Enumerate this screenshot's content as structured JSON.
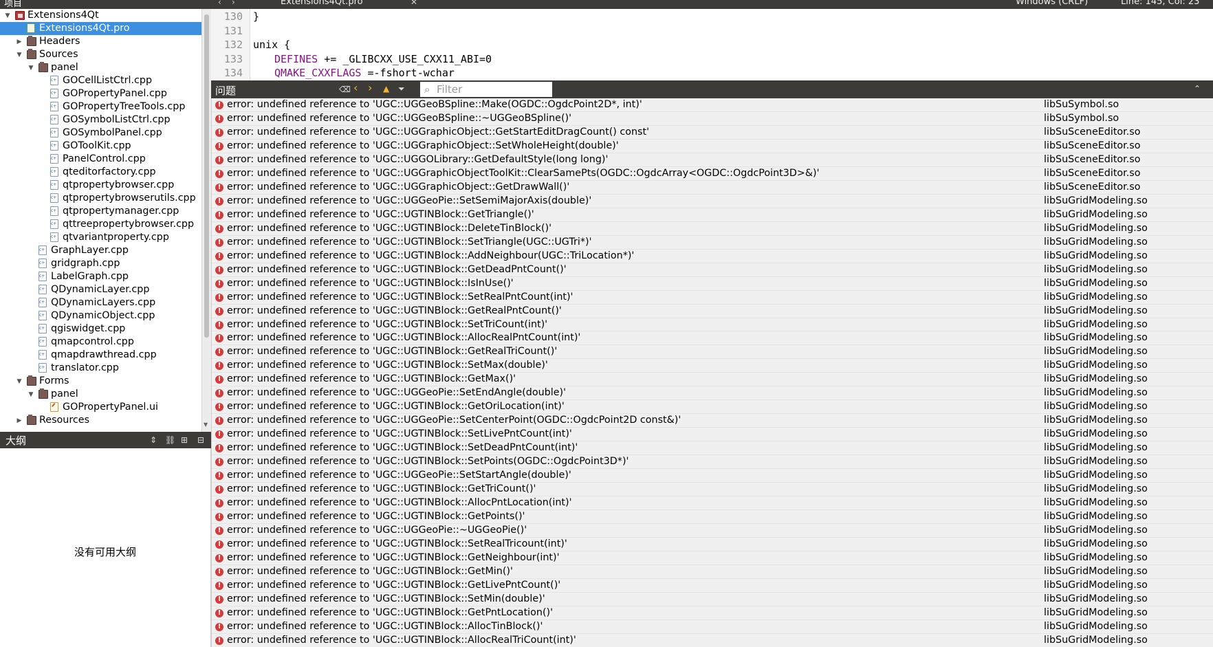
{
  "project_pane": {
    "title": "项目",
    "tree": [
      {
        "label": "Extensions4Qt",
        "type": "proj",
        "depth": 0,
        "arrow": "down"
      },
      {
        "label": "Extensions4Qt.pro",
        "type": "pro",
        "depth": 1,
        "selected": true
      },
      {
        "label": "Headers",
        "type": "folder",
        "depth": 1,
        "arrow": "right"
      },
      {
        "label": "Sources",
        "type": "folder",
        "depth": 1,
        "arrow": "down"
      },
      {
        "label": "panel",
        "type": "folder",
        "depth": 2,
        "arrow": "down"
      },
      {
        "label": "GOCellListCtrl.cpp",
        "type": "cpp",
        "depth": 3
      },
      {
        "label": "GOPropertyPanel.cpp",
        "type": "cpp",
        "depth": 3
      },
      {
        "label": "GOPropertyTreeTools.cpp",
        "type": "cpp",
        "depth": 3
      },
      {
        "label": "GOSymbolListCtrl.cpp",
        "type": "cpp",
        "depth": 3
      },
      {
        "label": "GOSymbolPanel.cpp",
        "type": "cpp",
        "depth": 3
      },
      {
        "label": "GOToolKit.cpp",
        "type": "cpp",
        "depth": 3
      },
      {
        "label": "PanelControl.cpp",
        "type": "cpp",
        "depth": 3
      },
      {
        "label": "qteditorfactory.cpp",
        "type": "cpp",
        "depth": 3
      },
      {
        "label": "qtpropertybrowser.cpp",
        "type": "cpp",
        "depth": 3
      },
      {
        "label": "qtpropertybrowserutils.cpp",
        "type": "cpp",
        "depth": 3
      },
      {
        "label": "qtpropertymanager.cpp",
        "type": "cpp",
        "depth": 3
      },
      {
        "label": "qttreepropertybrowser.cpp",
        "type": "cpp",
        "depth": 3
      },
      {
        "label": "qtvariantproperty.cpp",
        "type": "cpp",
        "depth": 3
      },
      {
        "label": "GraphLayer.cpp",
        "type": "cpp",
        "depth": 2
      },
      {
        "label": "gridgraph.cpp",
        "type": "cpp",
        "depth": 2
      },
      {
        "label": "LabelGraph.cpp",
        "type": "cpp",
        "depth": 2
      },
      {
        "label": "QDynamicLayer.cpp",
        "type": "cpp",
        "depth": 2
      },
      {
        "label": "QDynamicLayers.cpp",
        "type": "cpp",
        "depth": 2
      },
      {
        "label": "QDynamicObject.cpp",
        "type": "cpp",
        "depth": 2
      },
      {
        "label": "qgiswidget.cpp",
        "type": "cpp",
        "depth": 2
      },
      {
        "label": "qmapcontrol.cpp",
        "type": "cpp",
        "depth": 2
      },
      {
        "label": "qmapdrawthread.cpp",
        "type": "cpp",
        "depth": 2
      },
      {
        "label": "translator.cpp",
        "type": "cpp",
        "depth": 2
      },
      {
        "label": "Forms",
        "type": "folder",
        "depth": 1,
        "arrow": "down"
      },
      {
        "label": "panel",
        "type": "folder",
        "depth": 2,
        "arrow": "down"
      },
      {
        "label": "GOPropertyPanel.ui",
        "type": "ui",
        "depth": 3
      },
      {
        "label": "Resources",
        "type": "folder",
        "depth": 1,
        "arrow": "right"
      }
    ]
  },
  "outline_pane": {
    "title": "大纲",
    "empty_text": "没有可用大纲"
  },
  "editor": {
    "file_name": "Extensions4Qt.pro",
    "line_ending": "Windows (CRLF)",
    "cursor_pos": "Line: 145, Col: 23",
    "lines": [
      {
        "num": "130",
        "text": "}"
      },
      {
        "num": "131",
        "text": ""
      },
      {
        "num": "132",
        "text": "unix {"
      },
      {
        "num": "133",
        "kw": "DEFINES",
        "rest": " += _GLIBCXX_USE_CXX11_ABI=0"
      },
      {
        "num": "134",
        "kw": "QMAKE_CXXFLAGS",
        "rest": " =-fshort-wchar"
      }
    ]
  },
  "issues": {
    "title": "问题",
    "filter_placeholder": "Filter",
    "rows": [
      {
        "msg": "error: undefined reference to 'UGC::UGGeoBSpline::Make(OGDC::OgdcPoint2D*, int)'",
        "file": "libSuSymbol.so"
      },
      {
        "msg": "error: undefined reference to 'UGC::UGGeoBSpline::~UGGeoBSpline()'",
        "file": "libSuSymbol.so"
      },
      {
        "msg": "error: undefined reference to 'UGC::UGGraphicObject::GetStartEditDragCount() const'",
        "file": "libSuSceneEditor.so"
      },
      {
        "msg": "error: undefined reference to 'UGC::UGGraphicObject::SetWholeHeight(double)'",
        "file": "libSuSceneEditor.so"
      },
      {
        "msg": "error: undefined reference to 'UGC::UGGOLibrary::GetDefaultStyle(long long)'",
        "file": "libSuSceneEditor.so"
      },
      {
        "msg": "error: undefined reference to 'UGC::UGGraphicObjectToolKit::ClearSamePts(OGDC::OgdcArray<OGDC::OgdcPoint3D>&)'",
        "file": "libSuSceneEditor.so"
      },
      {
        "msg": "error: undefined reference to 'UGC::UGGraphicObject::GetDrawWall()'",
        "file": "libSuSceneEditor.so"
      },
      {
        "msg": "error: undefined reference to 'UGC::UGGeoPie::SetSemiMajorAxis(double)'",
        "file": "libSuGridModeling.so"
      },
      {
        "msg": "error: undefined reference to 'UGC::UGTINBlock::GetTriangle()'",
        "file": "libSuGridModeling.so"
      },
      {
        "msg": "error: undefined reference to 'UGC::UGTINBlock::DeleteTinBlock()'",
        "file": "libSuGridModeling.so"
      },
      {
        "msg": "error: undefined reference to 'UGC::UGTINBlock::SetTriangle(UGC::UGTri*)'",
        "file": "libSuGridModeling.so"
      },
      {
        "msg": "error: undefined reference to 'UGC::UGTINBlock::AddNeighbour(UGC::TriLocation*)'",
        "file": "libSuGridModeling.so"
      },
      {
        "msg": "error: undefined reference to 'UGC::UGTINBlock::GetDeadPntCount()'",
        "file": "libSuGridModeling.so"
      },
      {
        "msg": "error: undefined reference to 'UGC::UGTINBlock::IsInUse()'",
        "file": "libSuGridModeling.so"
      },
      {
        "msg": "error: undefined reference to 'UGC::UGTINBlock::SetRealPntCount(int)'",
        "file": "libSuGridModeling.so"
      },
      {
        "msg": "error: undefined reference to 'UGC::UGTINBlock::GetRealPntCount()'",
        "file": "libSuGridModeling.so"
      },
      {
        "msg": "error: undefined reference to 'UGC::UGTINBlock::SetTriCount(int)'",
        "file": "libSuGridModeling.so"
      },
      {
        "msg": "error: undefined reference to 'UGC::UGTINBlock::AllocRealPntCount(int)'",
        "file": "libSuGridModeling.so"
      },
      {
        "msg": "error: undefined reference to 'UGC::UGTINBlock::GetRealTriCount()'",
        "file": "libSuGridModeling.so"
      },
      {
        "msg": "error: undefined reference to 'UGC::UGTINBlock::SetMax(double)'",
        "file": "libSuGridModeling.so"
      },
      {
        "msg": "error: undefined reference to 'UGC::UGTINBlock::GetMax()'",
        "file": "libSuGridModeling.so"
      },
      {
        "msg": "error: undefined reference to 'UGC::UGGeoPie::SetEndAngle(double)'",
        "file": "libSuGridModeling.so"
      },
      {
        "msg": "error: undefined reference to 'UGC::UGTINBlock::GetOriLocation(int)'",
        "file": "libSuGridModeling.so"
      },
      {
        "msg": "error: undefined reference to 'UGC::UGGeoPie::SetCenterPoint(OGDC::OgdcPoint2D const&)'",
        "file": "libSuGridModeling.so"
      },
      {
        "msg": "error: undefined reference to 'UGC::UGTINBlock::SetLivePntCount(int)'",
        "file": "libSuGridModeling.so"
      },
      {
        "msg": "error: undefined reference to 'UGC::UGTINBlock::SetDeadPntCount(int)'",
        "file": "libSuGridModeling.so"
      },
      {
        "msg": "error: undefined reference to 'UGC::UGTINBlock::SetPoints(OGDC::OgdcPoint3D*)'",
        "file": "libSuGridModeling.so"
      },
      {
        "msg": "error: undefined reference to 'UGC::UGGeoPie::SetStartAngle(double)'",
        "file": "libSuGridModeling.so"
      },
      {
        "msg": "error: undefined reference to 'UGC::UGTINBlock::GetTriCount()'",
        "file": "libSuGridModeling.so"
      },
      {
        "msg": "error: undefined reference to 'UGC::UGTINBlock::AllocPntLocation(int)'",
        "file": "libSuGridModeling.so"
      },
      {
        "msg": "error: undefined reference to 'UGC::UGTINBlock::GetPoints()'",
        "file": "libSuGridModeling.so"
      },
      {
        "msg": "error: undefined reference to 'UGC::UGGeoPie::~UGGeoPie()'",
        "file": "libSuGridModeling.so"
      },
      {
        "msg": "error: undefined reference to 'UGC::UGTINBlock::SetRealTricount(int)'",
        "file": "libSuGridModeling.so"
      },
      {
        "msg": "error: undefined reference to 'UGC::UGTINBlock::GetNeighbour(int)'",
        "file": "libSuGridModeling.so"
      },
      {
        "msg": "error: undefined reference to 'UGC::UGTINBlock::GetMin()'",
        "file": "libSuGridModeling.so"
      },
      {
        "msg": "error: undefined reference to 'UGC::UGTINBlock::GetLivePntCount()'",
        "file": "libSuGridModeling.so"
      },
      {
        "msg": "error: undefined reference to 'UGC::UGTINBlock::SetMin(double)'",
        "file": "libSuGridModeling.so"
      },
      {
        "msg": "error: undefined reference to 'UGC::UGTINBlock::GetPntLocation()'",
        "file": "libSuGridModeling.so"
      },
      {
        "msg": "error: undefined reference to 'UGC::UGTINBlock::AllocTinBlock()'",
        "file": "libSuGridModeling.so"
      },
      {
        "msg": "error: undefined reference to 'UGC::UGTINBlock::AllocRealTriCount(int)'",
        "file": "libSuGridModeling.so"
      }
    ]
  }
}
